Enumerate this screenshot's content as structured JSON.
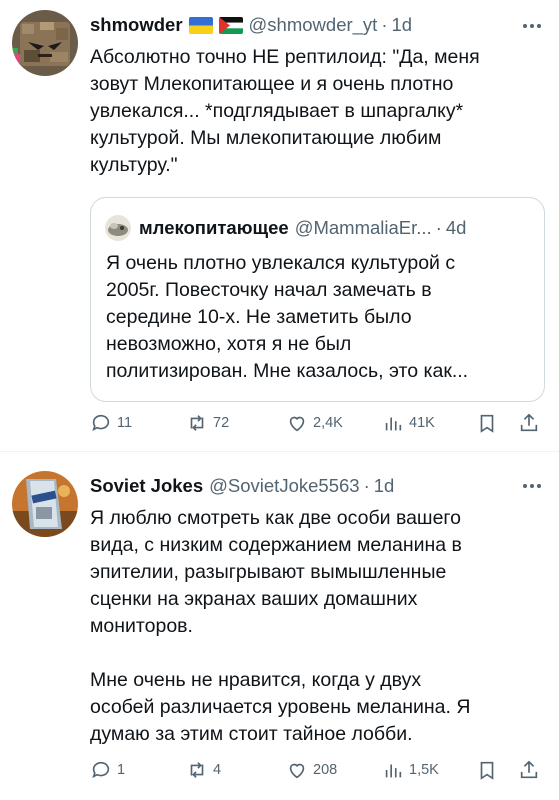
{
  "tweets": [
    {
      "name": "shmowder",
      "handle": "@shmowder_yt",
      "time": "1d",
      "flags": [
        "ukraine-flag-icon",
        "palestine-flag-icon"
      ],
      "text": [
        "Абсолютно точно НЕ рептилоид: \"Да, меня",
        "зовут Млекопитающее и я очень плотно",
        "увлекался... *подглядывает в шпаргалку*",
        "культурой. Мы млекопитающие любим",
        "культуру.\""
      ],
      "quote": {
        "name": "млекопитающее",
        "handle": "@MammaliaEr...",
        "time": "4d",
        "text": [
          "Я очень плотно увлекался культурой с",
          "2005г. Повесточку начал замечать в",
          "середине 10-х. Не заметить было",
          "невозможно, хотя я не был",
          "политизирован. Мне казалось, это как..."
        ]
      },
      "stats": {
        "replies": "11",
        "reposts": "72",
        "likes": "2,4K",
        "views": "41K"
      }
    },
    {
      "name": "Soviet Jokes",
      "handle": "@SovietJoke5563",
      "time": "1d",
      "text": [
        "Я люблю смотреть как две особи вашего",
        "вида, с низким содержанием меланина в",
        "эпителии, разыгрывают вымышленные",
        "сценки на экранах ваших домашних",
        "мониторов."
      ],
      "text2": [
        "Мне очень не нравится, когда у двух",
        "особей различается уровень меланина. Я",
        "думаю за этим стоит тайное лобби."
      ],
      "stats": {
        "replies": "1",
        "reposts": "4",
        "likes": "208",
        "views": "1,5K"
      }
    }
  ],
  "colors": {
    "text": "#0f1419",
    "secondary": "#536471",
    "border": "#cfd9de"
  }
}
